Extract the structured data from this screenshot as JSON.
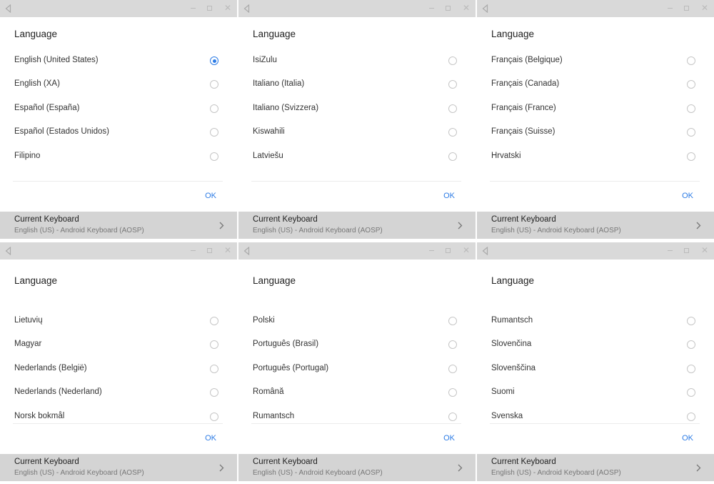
{
  "panels": [
    {
      "title": "Language",
      "options": [
        {
          "label": "English (United States)",
          "selected": true
        },
        {
          "label": "English (XA)",
          "selected": false
        },
        {
          "label": "Español (España)",
          "selected": false
        },
        {
          "label": "Español (Estados Unidos)",
          "selected": false
        },
        {
          "label": "Filipino",
          "selected": false
        }
      ],
      "ok_label": "OK",
      "keyboard": {
        "title": "Current Keyboard",
        "subtitle": "English (US) - Android Keyboard (AOSP)"
      }
    },
    {
      "title": "Language",
      "options": [
        {
          "label": "IsiZulu",
          "selected": false
        },
        {
          "label": "Italiano (Italia)",
          "selected": false
        },
        {
          "label": "Italiano (Svizzera)",
          "selected": false
        },
        {
          "label": "Kiswahili",
          "selected": false
        },
        {
          "label": "Latviešu",
          "selected": false
        }
      ],
      "ok_label": "OK",
      "keyboard": {
        "title": "Current Keyboard",
        "subtitle": "English (US) - Android Keyboard (AOSP)"
      }
    },
    {
      "title": "Language",
      "options": [
        {
          "label": "Français (Belgique)",
          "selected": false
        },
        {
          "label": "Français (Canada)",
          "selected": false
        },
        {
          "label": "Français (France)",
          "selected": false
        },
        {
          "label": "Français (Suisse)",
          "selected": false
        },
        {
          "label": "Hrvatski",
          "selected": false
        }
      ],
      "ok_label": "OK",
      "keyboard": {
        "title": "Current Keyboard",
        "subtitle": "English (US) - Android Keyboard (AOSP)"
      }
    },
    {
      "title": "Language",
      "options": [
        {
          "label": "Lietuvių",
          "selected": false
        },
        {
          "label": "Magyar",
          "selected": false
        },
        {
          "label": "Nederlands (België)",
          "selected": false
        },
        {
          "label": "Nederlands (Nederland)",
          "selected": false
        },
        {
          "label": "Norsk bokmål",
          "selected": false
        }
      ],
      "ok_label": "OK",
      "keyboard": {
        "title": "Current Keyboard",
        "subtitle": "English (US) - Android Keyboard (AOSP)"
      }
    },
    {
      "title": "Language",
      "options": [
        {
          "label": "Polski",
          "selected": false
        },
        {
          "label": "Português (Brasil)",
          "selected": false
        },
        {
          "label": "Português (Portugal)",
          "selected": false
        },
        {
          "label": "Română",
          "selected": false
        },
        {
          "label": "Rumantsch",
          "selected": false
        }
      ],
      "ok_label": "OK",
      "keyboard": {
        "title": "Current Keyboard",
        "subtitle": "English (US) - Android Keyboard (AOSP)"
      }
    },
    {
      "title": "Language",
      "options": [
        {
          "label": "Rumantsch",
          "selected": false
        },
        {
          "label": "Slovenčina",
          "selected": false
        },
        {
          "label": "Slovenščina",
          "selected": false
        },
        {
          "label": "Suomi",
          "selected": false
        },
        {
          "label": "Svenska",
          "selected": false
        }
      ],
      "ok_label": "OK",
      "keyboard": {
        "title": "Current Keyboard",
        "subtitle": "English (US) - Android Keyboard (AOSP)"
      }
    }
  ],
  "icons": {
    "back": "back-triangle-icon",
    "minimize": "minimize-icon",
    "maximize": "maximize-icon",
    "close": "close-icon",
    "chevron": "chevron-right-icon"
  },
  "colors": {
    "accent": "#2c7be5",
    "titlebar": "#d9d9d9",
    "keyboard_bar": "#d4d4d4"
  }
}
